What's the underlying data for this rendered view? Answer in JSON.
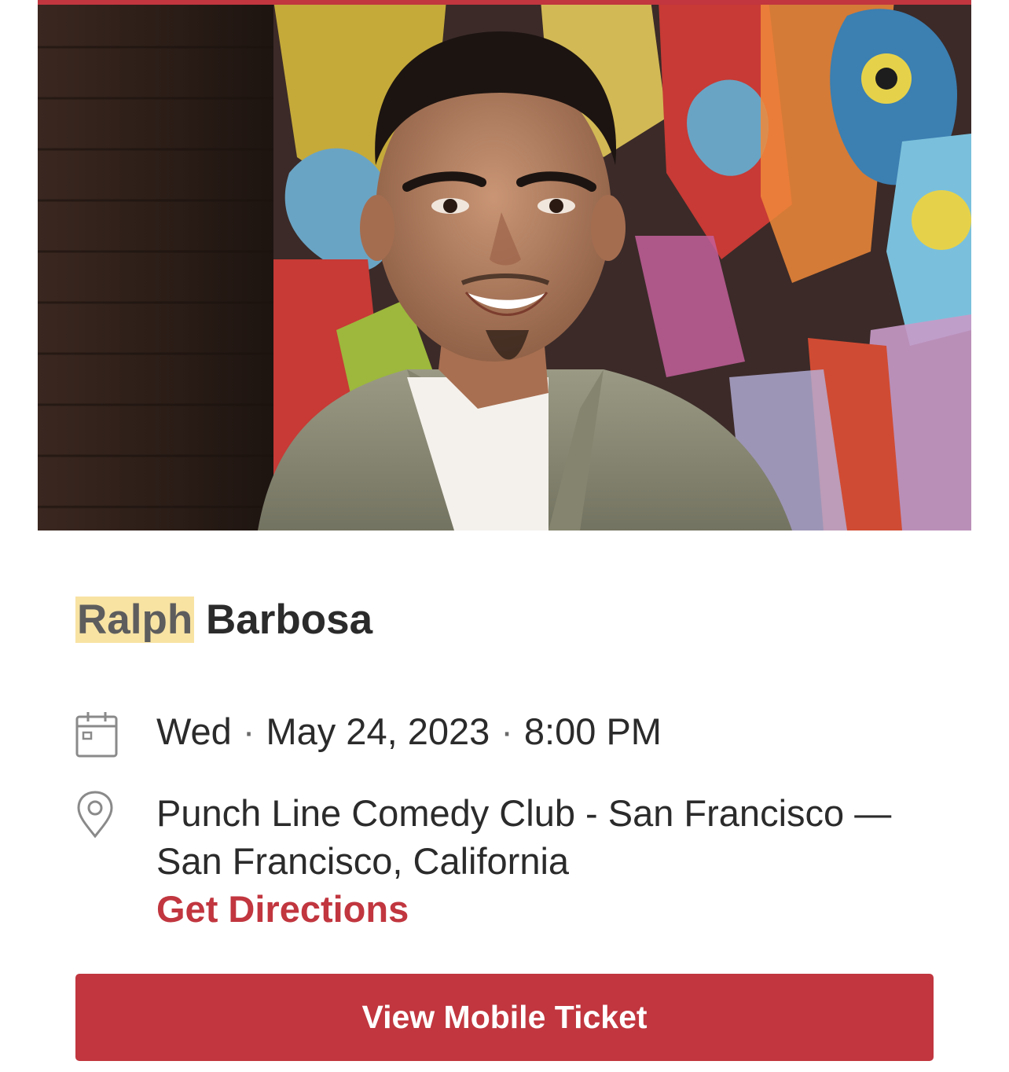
{
  "event": {
    "title_highlight": "Ralph",
    "title_rest": "Barbosa",
    "date": {
      "weekday": "Wed",
      "separator": "·",
      "date": "May 24, 2023",
      "time": "8:00 PM",
      "icon": "calendar-icon"
    },
    "location": {
      "line1": "Punch Line Comedy Club - San Francisco —",
      "line2": "San Francisco, California",
      "directions_label": "Get Directions",
      "icon": "map-pin-icon"
    },
    "cta_label": "View Mobile Ticket"
  },
  "colors": {
    "accent": "#c1363f",
    "highlight": "#f8e3a3",
    "text": "#2b2b2b",
    "icon": "#8a8a8a"
  }
}
